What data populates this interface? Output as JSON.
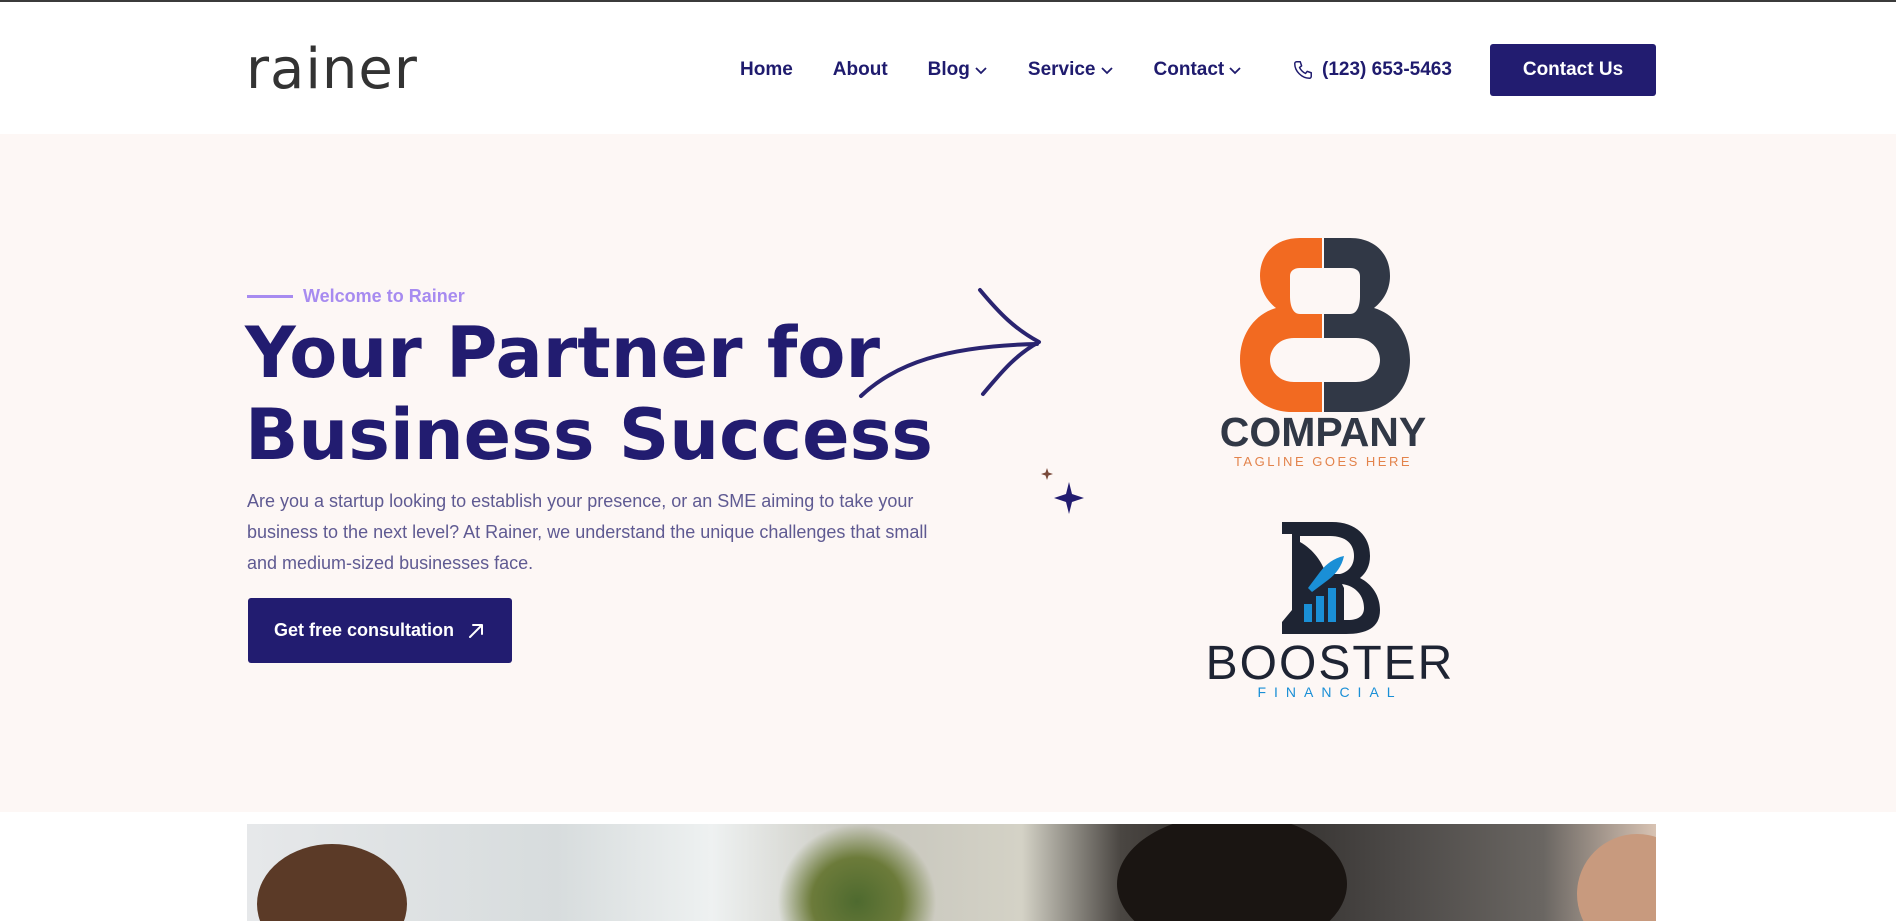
{
  "brand": {
    "logo_text": "rainer"
  },
  "nav": {
    "items": [
      {
        "label": "Home",
        "has_dropdown": false
      },
      {
        "label": "About",
        "has_dropdown": false
      },
      {
        "label": "Blog",
        "has_dropdown": true
      },
      {
        "label": "Service",
        "has_dropdown": true
      },
      {
        "label": "Contact",
        "has_dropdown": true
      }
    ],
    "phone": "(123) 653-5463",
    "contact_button": "Contact Us"
  },
  "hero": {
    "eyebrow": "Welcome to Rainer",
    "title_line1": "Your Partner for",
    "title_line2": "Business Success",
    "description": "Are you a startup looking to establish your presence, or an SME aiming to take your business to the next level? At Rainer, we understand the unique challenges that small and medium-sized businesses face.",
    "cta_label": "Get free consultation"
  },
  "partners": {
    "company": {
      "name": "COMPANY",
      "tagline": "TAGLINE GOES HERE"
    },
    "booster": {
      "name": "BOOSTER",
      "subtitle": "FINANCIAL"
    }
  },
  "colors": {
    "primary": "#221c70",
    "accent_lavender": "#a78bf0",
    "hero_bg": "#fdf7f5",
    "company_orange": "#f26a21",
    "company_slate": "#313846",
    "booster_blue": "#1a8fd6"
  },
  "icons": {
    "phone": "phone-icon",
    "dropdown": "chevron-down-icon",
    "cta": "arrow-up-right-icon"
  }
}
